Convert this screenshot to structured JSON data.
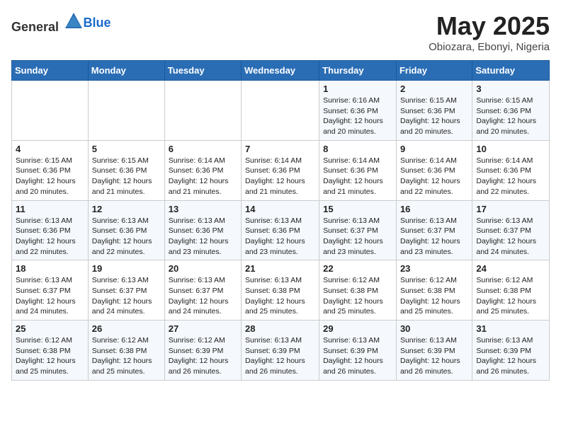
{
  "logo": {
    "text_general": "General",
    "text_blue": "Blue"
  },
  "title": "May 2025",
  "location": "Obiozara, Ebonyi, Nigeria",
  "header_days": [
    "Sunday",
    "Monday",
    "Tuesday",
    "Wednesday",
    "Thursday",
    "Friday",
    "Saturday"
  ],
  "weeks": [
    [
      {
        "day": "",
        "detail": ""
      },
      {
        "day": "",
        "detail": ""
      },
      {
        "day": "",
        "detail": ""
      },
      {
        "day": "",
        "detail": ""
      },
      {
        "day": "1",
        "detail": "Sunrise: 6:16 AM\nSunset: 6:36 PM\nDaylight: 12 hours\nand 20 minutes."
      },
      {
        "day": "2",
        "detail": "Sunrise: 6:15 AM\nSunset: 6:36 PM\nDaylight: 12 hours\nand 20 minutes."
      },
      {
        "day": "3",
        "detail": "Sunrise: 6:15 AM\nSunset: 6:36 PM\nDaylight: 12 hours\nand 20 minutes."
      }
    ],
    [
      {
        "day": "4",
        "detail": "Sunrise: 6:15 AM\nSunset: 6:36 PM\nDaylight: 12 hours\nand 20 minutes."
      },
      {
        "day": "5",
        "detail": "Sunrise: 6:15 AM\nSunset: 6:36 PM\nDaylight: 12 hours\nand 21 minutes."
      },
      {
        "day": "6",
        "detail": "Sunrise: 6:14 AM\nSunset: 6:36 PM\nDaylight: 12 hours\nand 21 minutes."
      },
      {
        "day": "7",
        "detail": "Sunrise: 6:14 AM\nSunset: 6:36 PM\nDaylight: 12 hours\nand 21 minutes."
      },
      {
        "day": "8",
        "detail": "Sunrise: 6:14 AM\nSunset: 6:36 PM\nDaylight: 12 hours\nand 21 minutes."
      },
      {
        "day": "9",
        "detail": "Sunrise: 6:14 AM\nSunset: 6:36 PM\nDaylight: 12 hours\nand 22 minutes."
      },
      {
        "day": "10",
        "detail": "Sunrise: 6:14 AM\nSunset: 6:36 PM\nDaylight: 12 hours\nand 22 minutes."
      }
    ],
    [
      {
        "day": "11",
        "detail": "Sunrise: 6:13 AM\nSunset: 6:36 PM\nDaylight: 12 hours\nand 22 minutes."
      },
      {
        "day": "12",
        "detail": "Sunrise: 6:13 AM\nSunset: 6:36 PM\nDaylight: 12 hours\nand 22 minutes."
      },
      {
        "day": "13",
        "detail": "Sunrise: 6:13 AM\nSunset: 6:36 PM\nDaylight: 12 hours\nand 23 minutes."
      },
      {
        "day": "14",
        "detail": "Sunrise: 6:13 AM\nSunset: 6:36 PM\nDaylight: 12 hours\nand 23 minutes."
      },
      {
        "day": "15",
        "detail": "Sunrise: 6:13 AM\nSunset: 6:37 PM\nDaylight: 12 hours\nand 23 minutes."
      },
      {
        "day": "16",
        "detail": "Sunrise: 6:13 AM\nSunset: 6:37 PM\nDaylight: 12 hours\nand 23 minutes."
      },
      {
        "day": "17",
        "detail": "Sunrise: 6:13 AM\nSunset: 6:37 PM\nDaylight: 12 hours\nand 24 minutes."
      }
    ],
    [
      {
        "day": "18",
        "detail": "Sunrise: 6:13 AM\nSunset: 6:37 PM\nDaylight: 12 hours\nand 24 minutes."
      },
      {
        "day": "19",
        "detail": "Sunrise: 6:13 AM\nSunset: 6:37 PM\nDaylight: 12 hours\nand 24 minutes."
      },
      {
        "day": "20",
        "detail": "Sunrise: 6:13 AM\nSunset: 6:37 PM\nDaylight: 12 hours\nand 24 minutes."
      },
      {
        "day": "21",
        "detail": "Sunrise: 6:13 AM\nSunset: 6:38 PM\nDaylight: 12 hours\nand 25 minutes."
      },
      {
        "day": "22",
        "detail": "Sunrise: 6:12 AM\nSunset: 6:38 PM\nDaylight: 12 hours\nand 25 minutes."
      },
      {
        "day": "23",
        "detail": "Sunrise: 6:12 AM\nSunset: 6:38 PM\nDaylight: 12 hours\nand 25 minutes."
      },
      {
        "day": "24",
        "detail": "Sunrise: 6:12 AM\nSunset: 6:38 PM\nDaylight: 12 hours\nand 25 minutes."
      }
    ],
    [
      {
        "day": "25",
        "detail": "Sunrise: 6:12 AM\nSunset: 6:38 PM\nDaylight: 12 hours\nand 25 minutes."
      },
      {
        "day": "26",
        "detail": "Sunrise: 6:12 AM\nSunset: 6:38 PM\nDaylight: 12 hours\nand 25 minutes."
      },
      {
        "day": "27",
        "detail": "Sunrise: 6:12 AM\nSunset: 6:39 PM\nDaylight: 12 hours\nand 26 minutes."
      },
      {
        "day": "28",
        "detail": "Sunrise: 6:13 AM\nSunset: 6:39 PM\nDaylight: 12 hours\nand 26 minutes."
      },
      {
        "day": "29",
        "detail": "Sunrise: 6:13 AM\nSunset: 6:39 PM\nDaylight: 12 hours\nand 26 minutes."
      },
      {
        "day": "30",
        "detail": "Sunrise: 6:13 AM\nSunset: 6:39 PM\nDaylight: 12 hours\nand 26 minutes."
      },
      {
        "day": "31",
        "detail": "Sunrise: 6:13 AM\nSunset: 6:39 PM\nDaylight: 12 hours\nand 26 minutes."
      }
    ]
  ]
}
